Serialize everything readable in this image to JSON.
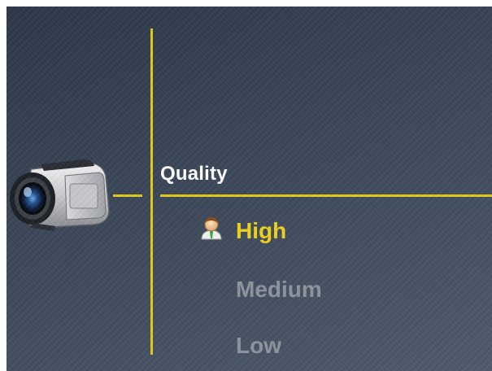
{
  "menu": {
    "category_icon": "camcorder-icon",
    "category_label": "Quality",
    "options": [
      {
        "label": "High",
        "selected": true,
        "icon": "user-icon"
      },
      {
        "label": "Medium",
        "selected": false
      },
      {
        "label": "Low",
        "selected": false
      }
    ]
  },
  "colors": {
    "accent": "#e2c91b",
    "selected_text": "#efd21a",
    "dim_text": "#8e949c",
    "background": "#3a4658"
  }
}
